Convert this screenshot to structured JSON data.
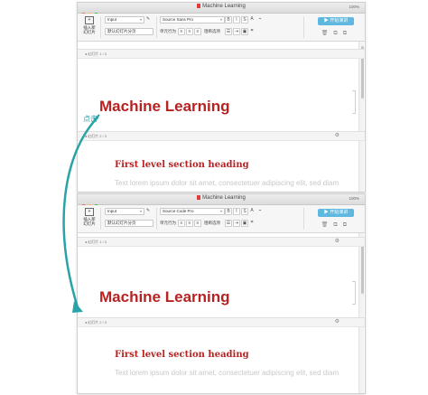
{
  "annotation": "点击",
  "colors": {
    "accent": "#2ba3a6",
    "heading": "#b72222",
    "present": "#5fb8df"
  },
  "windows": [
    {
      "title": "Machine Learning",
      "zoom": "100%",
      "toolbar": {
        "new_slide_line1": "插入新",
        "new_slide_line2": "幻灯片",
        "layout_value": "Input",
        "layout_sub": "默认幻灯片分页",
        "font_name": "Source Sans Pro",
        "font_sub": "单元行为",
        "font_sub2": "阻断选项",
        "present_label": "开始演讲",
        "bold": "B",
        "italic": "I",
        "strike": "S",
        "letter_a": "A"
      },
      "slides": [
        {
          "label": "◂ 幻灯片 1 / 3",
          "heading": "Machine Learning"
        },
        {
          "label": "◂ 幻灯片 2 / 3",
          "heading": "First level section heading",
          "text": "Text lorem ipsum dolor sit amet, consectetuer adipiscing elit, sed diam"
        }
      ]
    },
    {
      "title": "Machine Learning",
      "zoom": "100%",
      "toolbar": {
        "new_slide_line1": "插入新",
        "new_slide_line2": "幻灯片",
        "layout_value": "Input",
        "layout_sub": "默认幻灯片分页",
        "font_name": "Source Code Pro",
        "font_sub": "单元行为",
        "font_sub2": "阻断选项",
        "present_label": "开始演讲",
        "bold": "B",
        "italic": "I",
        "strike": "S",
        "letter_a": "A"
      },
      "slides": [
        {
          "label": "◂ 幻灯片 1 / 3",
          "heading": "Machine Learning"
        },
        {
          "label": "◂ 幻灯片 2 / 3",
          "heading": "First level section heading",
          "text": "Text lorem ipsum dolor sit amet, consectetuer adipiscing elit, sed diam"
        }
      ]
    }
  ]
}
